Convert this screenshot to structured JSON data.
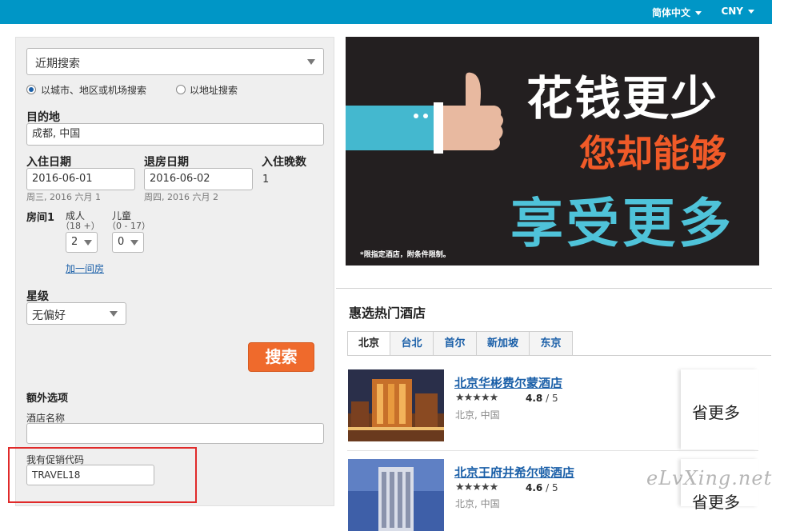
{
  "topbar": {
    "language": "简体中文",
    "currency": "CNY"
  },
  "search": {
    "recent_select": "近期搜索",
    "radio_city": "以城市、地区或机场搜索",
    "radio_address": "以地址搜索",
    "destination_label": "目的地",
    "destination_value": "成都, 中国",
    "checkin_label": "入住日期",
    "checkin_value": "2016-06-01",
    "checkin_hint": "周三, 2016 六月 1",
    "checkout_label": "退房日期",
    "checkout_value": "2016-06-02",
    "checkout_hint": "周四, 2016 六月 2",
    "nights_label": "入住晚数",
    "nights_value": "1",
    "room_label": "房间1",
    "adult_label": "成人",
    "adult_range": "（18 +）",
    "child_label": "儿童",
    "child_range": "（0 - 17）",
    "adult_value": "2",
    "child_value": "0",
    "add_room": "加一间房",
    "star_label": "星级",
    "star_value": "无偏好",
    "search_button": "搜索",
    "extra_label": "额外选项",
    "hotel_name_label": "酒店名称",
    "hotel_name_value": "",
    "promo_label": "我有促销代码",
    "promo_value": "TRAVEL18"
  },
  "banner": {
    "line1": "花钱更少",
    "line2": "您却能够",
    "line3": "享受更多",
    "note": "*限指定酒店，附条件限制。",
    "colors": {
      "background": "#231f20",
      "line2": "#f05a28",
      "line3": "#4fc3d9"
    }
  },
  "hotels_section": {
    "title": "惠选热门酒店",
    "tabs": [
      "北京",
      "台北",
      "首尔",
      "新加坡",
      "东京"
    ],
    "active_tab": "北京",
    "hotels": [
      {
        "name": "北京华彬费尔蒙酒店",
        "stars": "★★★★★",
        "rating": "4.8",
        "rating_max": "/ 5",
        "location": "北京, 中国",
        "badge": "省更多"
      },
      {
        "name": "北京王府井希尔顿酒店",
        "stars": "★★★★★",
        "rating": "4.6",
        "rating_max": "/ 5",
        "location": "北京, 中国",
        "badge": "省更多"
      }
    ]
  },
  "watermark": "eLvXing.net"
}
